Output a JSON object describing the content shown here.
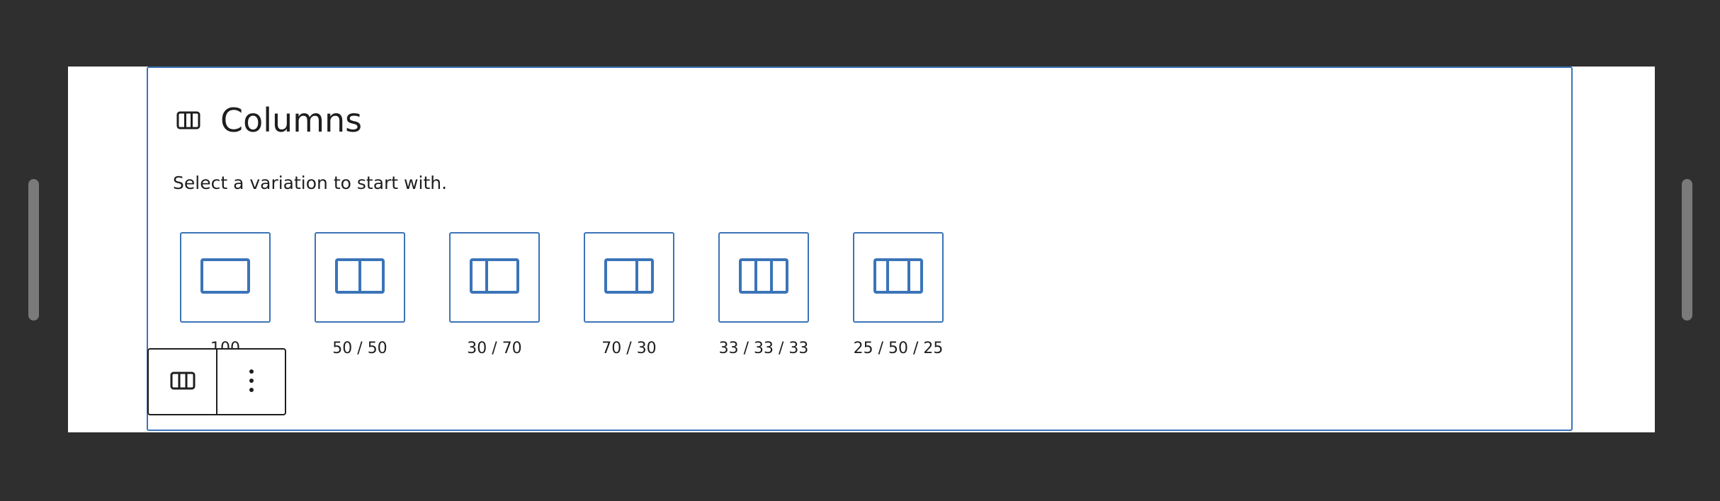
{
  "placeholder": {
    "title": "Columns",
    "instructions": "Select a variation to start with."
  },
  "variations": [
    {
      "label": "100",
      "icon": "columns-100-icon"
    },
    {
      "label": "50 / 50",
      "icon": "columns-50-50-icon"
    },
    {
      "label": "30 / 70",
      "icon": "columns-30-70-icon"
    },
    {
      "label": "70 / 30",
      "icon": "columns-70-30-icon"
    },
    {
      "label": "33 / 33 / 33",
      "icon": "columns-33-33-33-icon"
    },
    {
      "label": "25 / 50 / 25",
      "icon": "columns-25-50-25-icon"
    }
  ],
  "toolbar": {
    "block_type_icon": "columns-icon",
    "options_icon": "more-vertical-icon"
  },
  "colors": {
    "accent": "#3b74b8",
    "text": "#1e1e1e",
    "background": "#2f2f2f",
    "canvas": "#ffffff"
  }
}
